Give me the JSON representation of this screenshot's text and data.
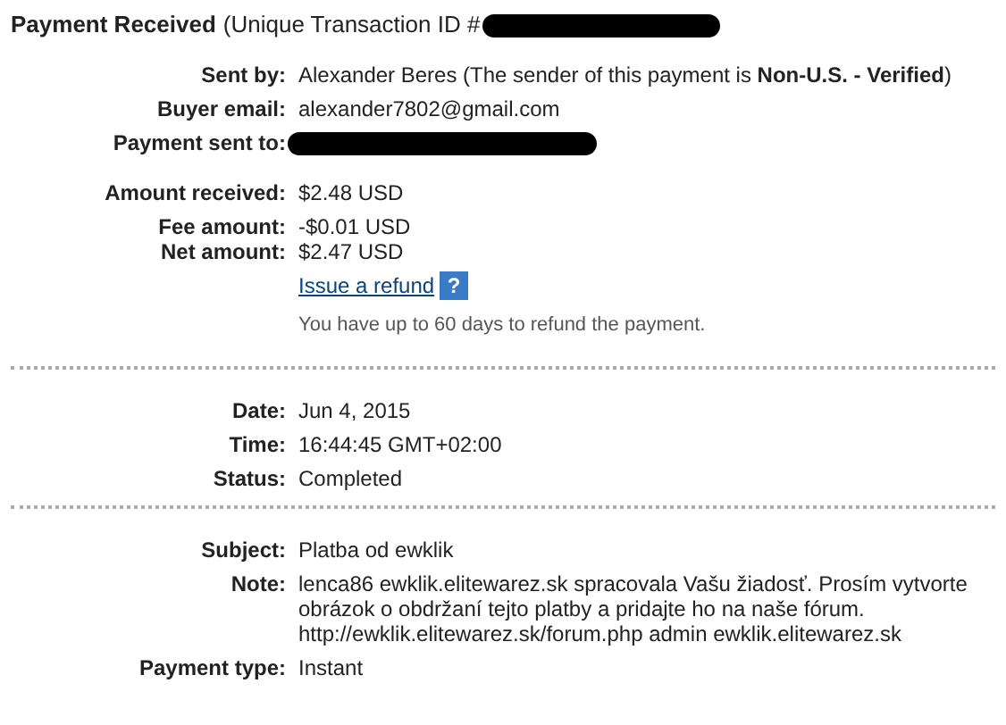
{
  "header": {
    "title": "Payment Received",
    "subtitle": "(Unique Transaction ID #",
    "id_redacted": true
  },
  "sections": [
    {
      "groups": [
        [
          {
            "label": "Sent by:",
            "value": "Alexander Beres (The sender of this payment is **Non-U.S. - Verified**)"
          },
          {
            "label": "Buyer email:",
            "value": "alexander7802@gmail.com"
          },
          {
            "label": "Payment sent to:",
            "kind": "redacted"
          }
        ],
        [
          {
            "label": "Amount received:",
            "value": "$2.48 USD"
          }
        ],
        [
          {
            "label": "Fee amount:",
            "value": "-$0.01 USD"
          },
          {
            "label": "Net amount:",
            "value": "$2.47 USD"
          }
        ],
        [
          {
            "kind": "refund",
            "link": "Issue a refund",
            "help": "?",
            "hint": "You have up to 60 days to refund the payment."
          }
        ]
      ]
    },
    {
      "groups": [
        [
          {
            "label": "Date:",
            "value": "Jun 4, 2015"
          },
          {
            "label": "Time:",
            "value": "16:44:45 GMT+02:00"
          },
          {
            "label": "Status:",
            "value": "Completed"
          }
        ]
      ]
    },
    {
      "groups": [
        [
          {
            "label": "Subject:",
            "value": "Platba od ewklik"
          },
          {
            "label": "Note:",
            "value": "lenca86 ewklik.elitewarez.sk spracovala Vašu žiadosť. Prosím vytvorte obrázok o obdržaní tejto platby a pridajte ho na naše fórum. http://ewklik.elitewarez.sk/forum.php admin ewklik.elitewarez.sk"
          },
          {
            "label": "Payment type:",
            "value": "Instant"
          }
        ]
      ]
    }
  ]
}
